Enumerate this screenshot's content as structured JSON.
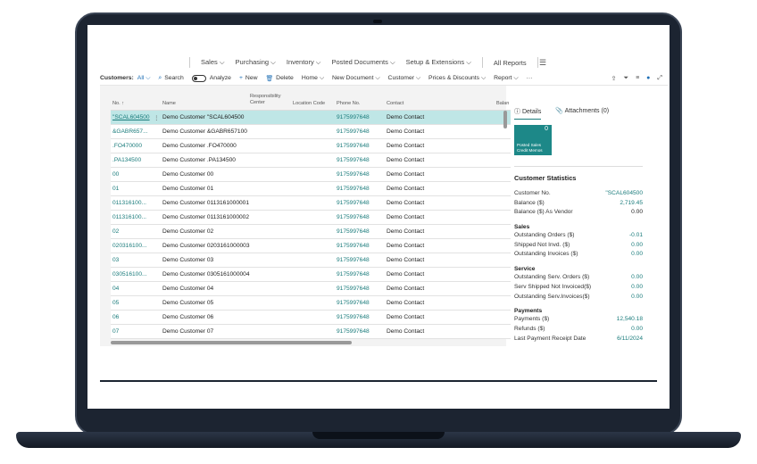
{
  "nav": {
    "menu": [
      "Sales",
      "Purchasing",
      "Inventory",
      "Posted Documents",
      "Setup & Extensions"
    ],
    "all_reports": "All Reports"
  },
  "actions": {
    "customers_label": "Customers:",
    "view": "All",
    "search": "Search",
    "analyze": "Analyze",
    "new": "New",
    "delete": "Delete",
    "home": "Home",
    "new_document": "New Document",
    "customer": "Customer",
    "prices_discounts": "Prices & Discounts",
    "report": "Report",
    "more": "···"
  },
  "columns": {
    "no": "No. ↑",
    "name": "Name",
    "resp": "Responsibility Center",
    "location": "Location Code",
    "phone": "Phone No.",
    "contact": "Contact",
    "balance": "Balan"
  },
  "rows": [
    {
      "no": "\"SCAL604500",
      "name": "Demo Customer \"SCAL604500",
      "phone": "9175997648",
      "contact": "Demo Contact"
    },
    {
      "no": "&GABR657...",
      "name": "Demo Customer &GABR657100",
      "phone": "9175997648",
      "contact": "Demo Contact"
    },
    {
      "no": ".FO470000",
      "name": "Demo Customer .FO470000",
      "phone": "9175997648",
      "contact": "Demo Contact"
    },
    {
      "no": ".PA134500",
      "name": "Demo Customer .PA134500",
      "phone": "9175997648",
      "contact": "Demo Contact"
    },
    {
      "no": "00",
      "name": "Demo Customer 00",
      "phone": "9175997648",
      "contact": "Demo Contact"
    },
    {
      "no": "01",
      "name": "Demo Customer 01",
      "phone": "9175997648",
      "contact": "Demo Contact"
    },
    {
      "no": "011316100...",
      "name": "Demo Customer 0113161000001",
      "phone": "9175997648",
      "contact": "Demo Contact"
    },
    {
      "no": "011316100...",
      "name": "Demo Customer 0113161000002",
      "phone": "9175997648",
      "contact": "Demo Contact"
    },
    {
      "no": "02",
      "name": "Demo Customer 02",
      "phone": "9175997648",
      "contact": "Demo Contact"
    },
    {
      "no": "020316100...",
      "name": "Demo Customer 0203161000003",
      "phone": "9175997648",
      "contact": "Demo Contact"
    },
    {
      "no": "03",
      "name": "Demo Customer 03",
      "phone": "9175997648",
      "contact": "Demo Contact"
    },
    {
      "no": "030516100...",
      "name": "Demo Customer 0305161000004",
      "phone": "9175997648",
      "contact": "Demo Contact"
    },
    {
      "no": "04",
      "name": "Demo Customer 04",
      "phone": "9175997648",
      "contact": "Demo Contact"
    },
    {
      "no": "05",
      "name": "Demo Customer 05",
      "phone": "9175997648",
      "contact": "Demo Contact"
    },
    {
      "no": "06",
      "name": "Demo Customer 06",
      "phone": "9175997648",
      "contact": "Demo Contact"
    },
    {
      "no": "07",
      "name": "Demo Customer 07",
      "phone": "9175997648",
      "contact": "Demo Contact"
    }
  ],
  "factbox": {
    "tab_details": "Details",
    "tab_attachments": "Attachments (0)",
    "tile_count": "0",
    "tile_label_1": "Posted Sales",
    "tile_label_2": "Credit Memos",
    "title": "Customer Statistics",
    "customer_no_label": "Customer No.",
    "customer_no": "\"SCAL604500",
    "balance_label": "Balance ($)",
    "balance": "2,719.45",
    "balance_vendor_label": "Balance ($) As Vendor",
    "balance_vendor": "0.00",
    "sales_title": "Sales",
    "out_orders_label": "Outstanding Orders ($)",
    "out_orders": "-0.01",
    "shipped_label": "Shipped Not Invd. ($)",
    "shipped": "0.00",
    "out_inv_label": "Outstanding Invoices ($)",
    "out_inv": "0.00",
    "service_title": "Service",
    "serv_orders_label": "Outstanding Serv. Orders ($)",
    "serv_orders": "0.00",
    "serv_shipped_label": "Serv Shipped Not Invoiced($)",
    "serv_shipped": "0.00",
    "serv_inv_label": "Outstanding Serv.Invoices($)",
    "serv_inv": "0.00",
    "payments_title": "Payments",
    "payments_label": "Payments ($)",
    "payments": "12,540.18",
    "refunds_label": "Refunds ($)",
    "refunds": "0.00",
    "last_payment_label": "Last Payment Receipt Date",
    "last_payment": "6/11/2024"
  },
  "colors": {
    "accent": "#1b7c7c",
    "selected_row": "#bfe6e6",
    "tile": "#1d8888",
    "bezel": "#1c2431"
  }
}
